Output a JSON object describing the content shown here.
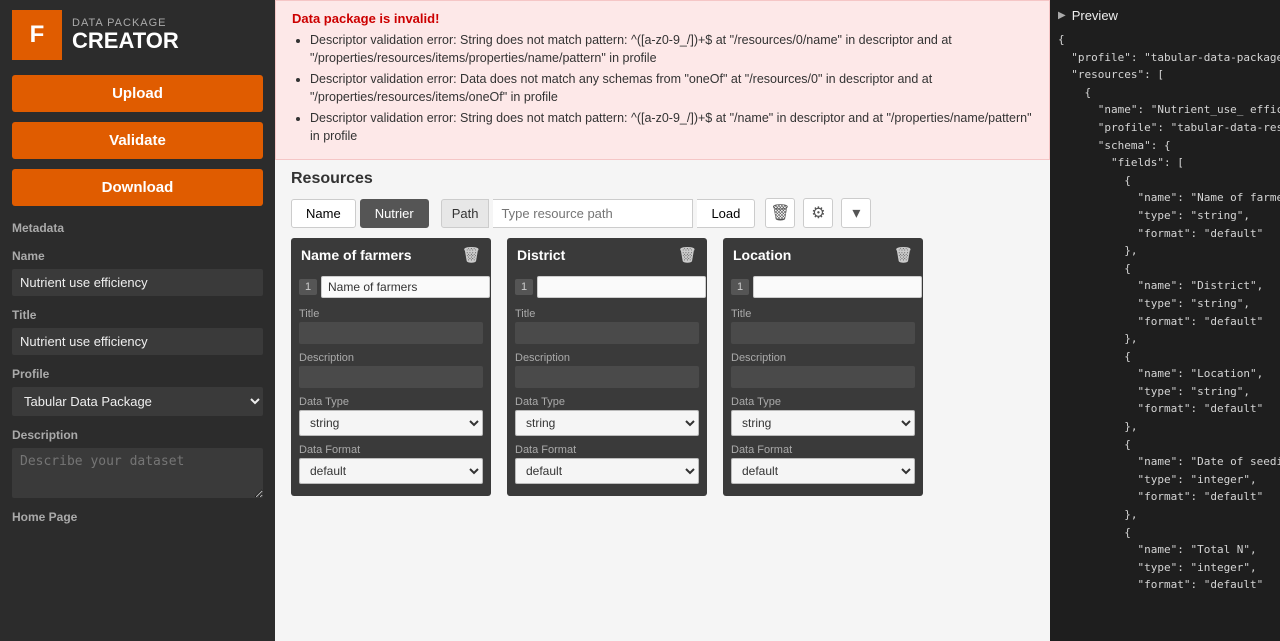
{
  "sidebar": {
    "logo_letter": "F",
    "subtitle": "DATA PACKAGE",
    "title": "CREATOR",
    "upload_label": "Upload",
    "validate_label": "Validate",
    "download_label": "Download",
    "metadata_label": "Metadata",
    "name_label": "Name",
    "name_value": "Nutrient use efficiency",
    "title_label": "Title",
    "title_value": "Nutrient use efficiency",
    "profile_label": "Profile",
    "profile_value": "Tabular Data Package",
    "description_label": "Description",
    "description_placeholder": "Describe your dataset",
    "homepage_label": "Home Page"
  },
  "errors": {
    "title": "Data package is invalid!",
    "items": [
      "Descriptor validation error: String does not match pattern: ^([a-z0-9_/])+$ at \"/resources/0/name\" in descriptor and at \"/properties/resources/items/properties/name/pattern\" in profile",
      "Descriptor validation error: Data does not match any schemas from \"oneOf\" at \"/resources/0\" in descriptor and at \"/properties/resources/items/oneOf\" in profile",
      "Descriptor validation error: String does not match pattern: ^([a-z0-9_/])+$ at \"/name\" in descriptor and at \"/properties/name/pattern\" in profile"
    ]
  },
  "resources": {
    "section_title": "Resources",
    "tabs": [
      {
        "label": "Name",
        "active": false
      },
      {
        "label": "Nutrier",
        "active": true
      }
    ],
    "path_label": "Path",
    "path_placeholder": "Type resource path",
    "load_label": "Load"
  },
  "fields": [
    {
      "name": "Name of farmers",
      "row_num": "1",
      "row_value": "Name of farmers",
      "title": "Title",
      "description": "Description",
      "data_type_label": "Data Type",
      "data_type": "string",
      "data_format_label": "Data Format",
      "data_format": "default"
    },
    {
      "name": "District",
      "row_num": "1",
      "row_value": "",
      "title": "Title",
      "description": "Description",
      "data_type_label": "Data Type",
      "data_type": "string",
      "data_format_label": "Data Format",
      "data_format": "default"
    },
    {
      "name": "Location",
      "row_num": "1",
      "row_value": "",
      "title": "Title",
      "description": "Description",
      "data_type_label": "Data Type",
      "data_type": "string",
      "data_format_label": "Data Format",
      "data_format": "default"
    }
  ],
  "preview": {
    "header": "Preview",
    "code": [
      "{",
      "  \"profile\": \"tabular-data-package\",",
      "  \"resources\": [",
      "    {",
      "      \"name\": \"Nutrient_use_ efficien",
      "      \"profile\": \"tabular-data-resou",
      "      \"schema\": {",
      "        \"fields\": [",
      "          {",
      "            \"name\": \"Name of farmers",
      "            \"type\": \"string\",",
      "            \"format\": \"default\"",
      "          },",
      "          {",
      "            \"name\": \"District\",",
      "            \"type\": \"string\",",
      "            \"format\": \"default\"",
      "          },",
      "          {",
      "            \"name\": \"Location\",",
      "            \"type\": \"string\",",
      "            \"format\": \"default\"",
      "          },",
      "          {",
      "            \"name\": \"Date of seeding",
      "            \"type\": \"integer\",",
      "            \"format\": \"default\"",
      "          },",
      "          {",
      "            \"name\": \"Total N\",",
      "            \"type\": \"integer\",",
      "            \"format\": \"default\""
    ]
  }
}
